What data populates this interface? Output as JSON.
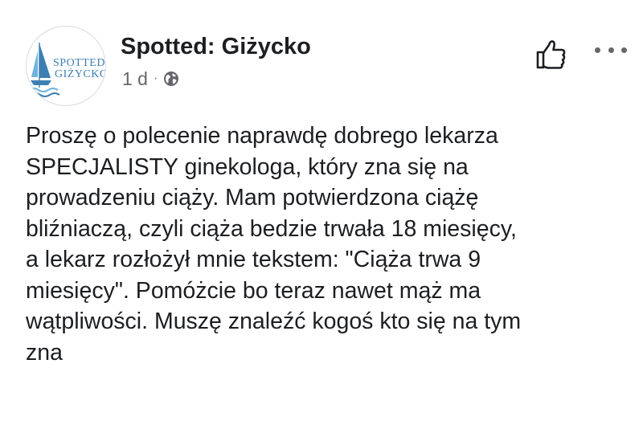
{
  "post": {
    "author": {
      "name": "Spotted: Giżycko",
      "avatar_text_line1": "SPOTTED",
      "avatar_text_line2": "GIŻYCKO",
      "avatar_icon": "sailboat-icon"
    },
    "meta": {
      "time": "1 d",
      "separator": "·",
      "audience_icon": "globe-icon"
    },
    "actions": {
      "like_icon": "thumbs-up-icon",
      "more_icon": "more-options-icon"
    },
    "body_lines": [
      "Proszę o polecenie naprawdę dobrego lekarza",
      "SPECJALISTY ginekologa, który zna się na",
      "prowadzeniu ciąży. Mam potwierdzona ciążę",
      "bliźniaczą, czyli ciąża bedzie trwała 18 miesięcy,",
      "a lekarz rozłożył mnie tekstem: \"Ciąża trwa 9",
      "miesięcy\". Pomóżcie bo teraz nawet mąż ma",
      "wątpliwości. Muszę znaleźć kogoś kto się na tym",
      "zna"
    ]
  },
  "colors": {
    "text_primary": "#1c1e21",
    "text_secondary": "#65676b",
    "logo_blue": "#3d7fb2",
    "logo_light_blue": "#6fb3de",
    "background": "#ffffff"
  }
}
